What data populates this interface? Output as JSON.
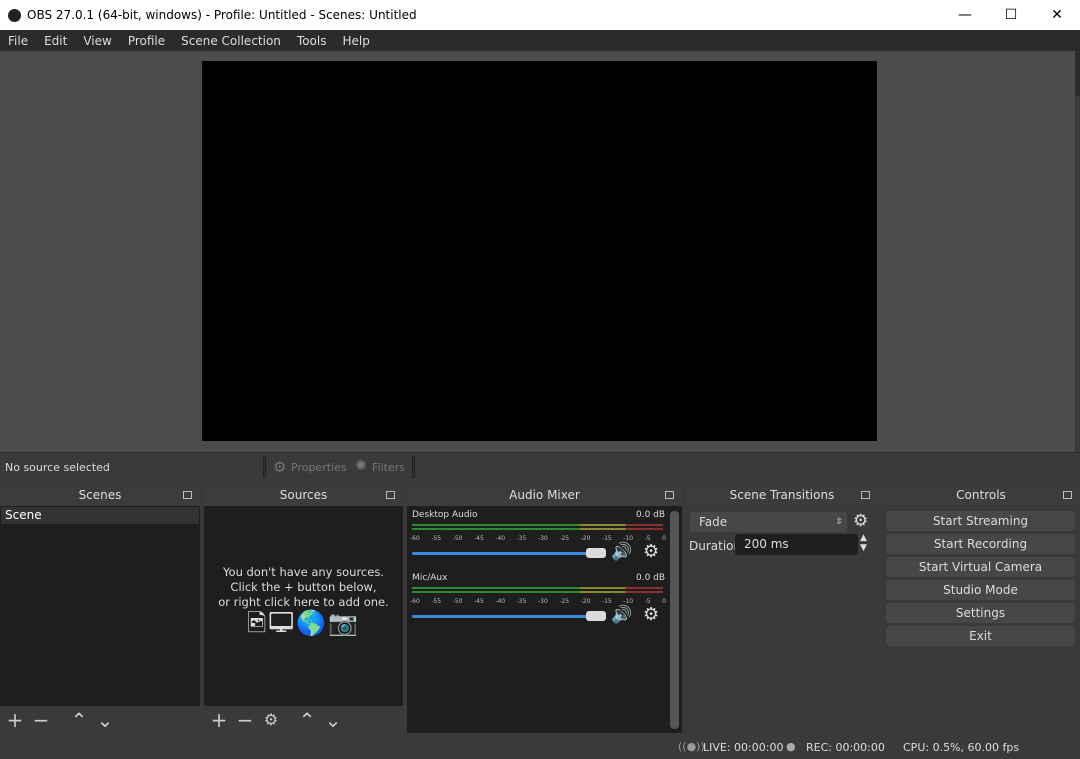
{
  "window": {
    "title": "OBS 27.0.1 (64-bit, windows) - Profile: Untitled - Scenes: Untitled",
    "minimize": "—",
    "maximize": "☐",
    "close": "✕"
  },
  "menu": [
    "File",
    "Edit",
    "View",
    "Profile",
    "Scene Collection",
    "Tools",
    "Help"
  ],
  "source_toolbar": {
    "status": "No source selected",
    "properties": "Properties",
    "filters": "Filters"
  },
  "scenes": {
    "title": "Scenes",
    "items": [
      "Scene"
    ]
  },
  "sources": {
    "title": "Sources",
    "empty_lines": [
      "You don't have any sources.",
      "Click the + button below,",
      "or right click here to add one."
    ]
  },
  "audio_mixer": {
    "title": "Audio Mixer",
    "ticks": [
      "-60",
      "-55",
      "-50",
      "-45",
      "-40",
      "-35",
      "-30",
      "-25",
      "-20",
      "-15",
      "-10",
      "-5",
      "0"
    ],
    "channels": [
      {
        "name": "Desktop Audio",
        "db": "0.0 dB",
        "volume": 1.0
      },
      {
        "name": "Mic/Aux",
        "db": "0.0 dB",
        "volume": 1.0
      }
    ]
  },
  "transitions": {
    "title": "Scene Transitions",
    "selected": "Fade",
    "duration_label": "Duration",
    "duration": "200 ms"
  },
  "controls": {
    "title": "Controls",
    "buttons": [
      "Start Streaming",
      "Start Recording",
      "Start Virtual Camera",
      "Studio Mode",
      "Settings",
      "Exit"
    ]
  },
  "status": {
    "live": "LIVE: 00:00:00",
    "rec": "REC: 00:00:00",
    "cpu": "CPU: 0.5%, 60.00 fps"
  },
  "colors": {
    "meter_green": "#2f8a2f",
    "meter_yellow": "#8a8a2f",
    "meter_red": "#8a2f2f",
    "slider": "#3b8ae0"
  }
}
